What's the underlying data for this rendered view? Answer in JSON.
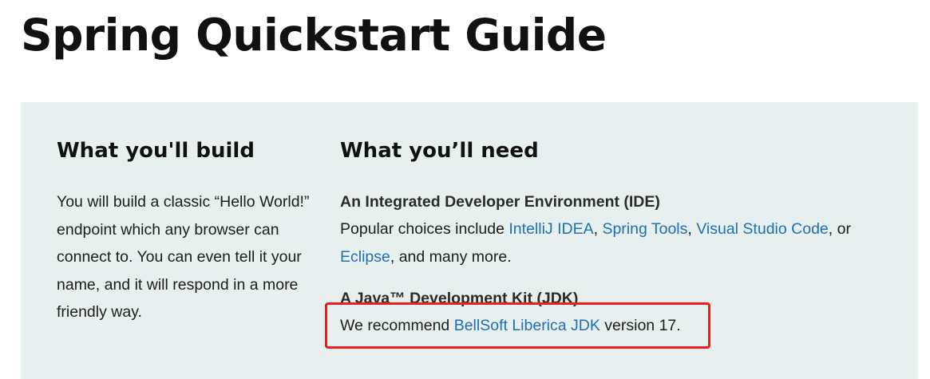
{
  "page": {
    "title": "Spring Quickstart Guide"
  },
  "build": {
    "heading": "What you'll build",
    "text": "You will build a classic “Hello World!” endpoint which any browser can connect to. You can even tell it your name, and it will respond in a more friendly way."
  },
  "need": {
    "heading": "What you’ll need",
    "ide": {
      "title": "An Integrated Developer Environment (IDE)",
      "prefix": "Popular choices include ",
      "links": [
        "IntelliJ IDEA",
        "Spring Tools",
        "Visual Studio Code",
        "Eclipse"
      ],
      "sep1": ", ",
      "sep2": ", ",
      "sep3": ", or ",
      "suffix": ", and many more."
    },
    "jdk": {
      "title": "A Java™ Development Kit (JDK)",
      "prefix": "We recommend ",
      "link": "BellSoft Liberica JDK",
      "suffix": " version 17."
    }
  },
  "colors": {
    "link": "#1f6fb5",
    "panel_background": "#e8efef",
    "highlight_border": "#e8231e"
  }
}
